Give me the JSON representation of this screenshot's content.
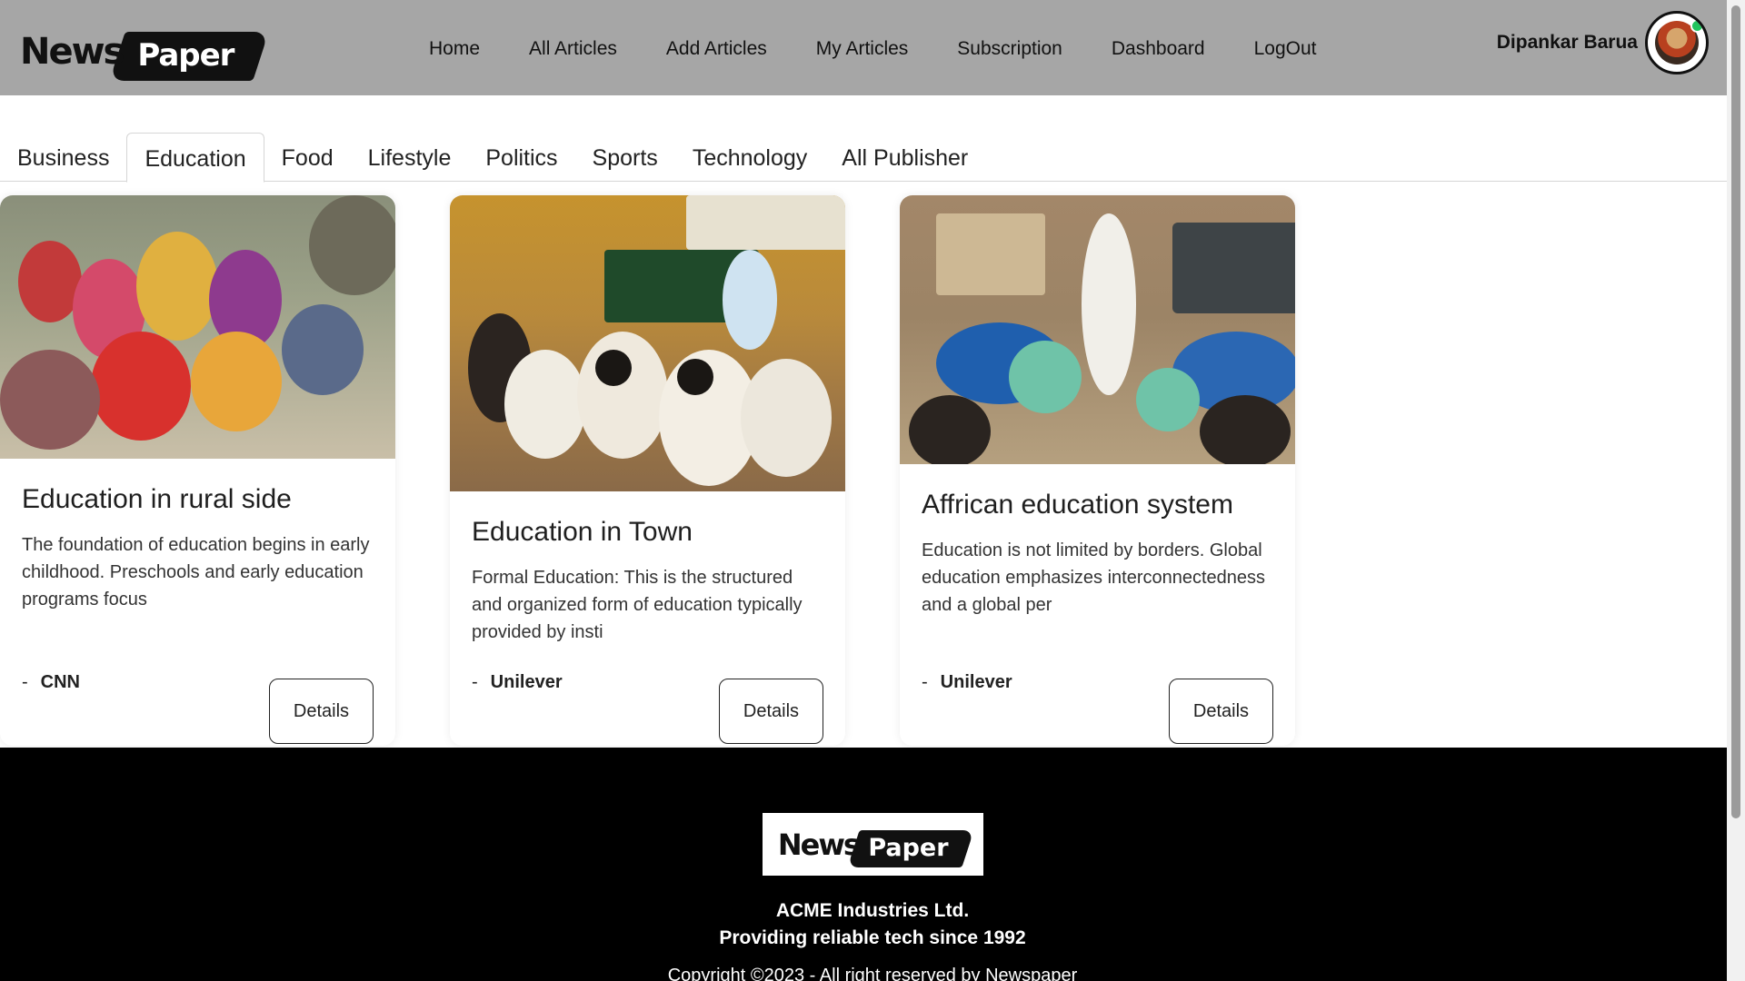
{
  "header": {
    "logo_left": "News",
    "logo_right": "Paper",
    "nav": [
      "Home",
      "All Articles",
      "Add Articles",
      "My Articles",
      "Subscription",
      "Dashboard",
      "LogOut"
    ],
    "username": "Dipankar Barua"
  },
  "tabs": {
    "items": [
      "Business",
      "Education",
      "Food",
      "Lifestyle",
      "Politics",
      "Sports",
      "Technology",
      "All Publisher"
    ],
    "active": "Education"
  },
  "cards": [
    {
      "title": "Education in rural side",
      "description": "The foundation of education begins in early childhood. Preschools and early education programs focus",
      "publisher": "CNN",
      "dash": "-",
      "button": "Details"
    },
    {
      "title": "Education in Town",
      "description": "Formal Education: This is the structured and organized form of education typically provided by insti",
      "publisher": "Unilever",
      "dash": "-",
      "button": "Details"
    },
    {
      "title": "Affrican education system",
      "description": "Education is not limited by borders. Global education emphasizes interconnectedness and a global per",
      "publisher": "Unilever",
      "dash": "-",
      "button": "Details"
    }
  ],
  "footer": {
    "logo_left": "News",
    "logo_right": "Paper",
    "company": "ACME Industries Ltd.",
    "tagline": "Providing reliable tech since 1992",
    "copyright": "Copyright ©2023 - All right reserved by Newspaper"
  }
}
